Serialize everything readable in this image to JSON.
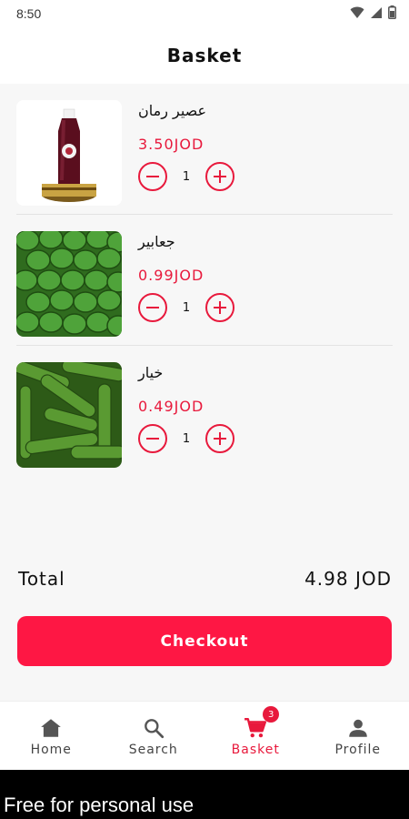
{
  "status_bar": {
    "time": "8:50"
  },
  "header": {
    "title": "Basket"
  },
  "items": [
    {
      "name": "عصير رمان",
      "price": "3.50JOD",
      "quantity": "1",
      "image": "pomegranate-juice-bottle"
    },
    {
      "name": "جعابير",
      "price": "0.99JOD",
      "quantity": "1",
      "image": "green-watermelons"
    },
    {
      "name": "خيار",
      "price": "0.49JOD",
      "quantity": "1",
      "image": "cucumbers"
    }
  ],
  "summary": {
    "total_label": "Total",
    "total_value": "4.98 JOD"
  },
  "checkout": {
    "label": "Checkout"
  },
  "nav": [
    {
      "label": "Home",
      "icon": "home-icon"
    },
    {
      "label": "Search",
      "icon": "search-icon"
    },
    {
      "label": "Basket",
      "icon": "cart-icon",
      "badge": "3",
      "active": true
    },
    {
      "label": "Profile",
      "icon": "person-icon"
    }
  ],
  "footer": {
    "text": "Free for personal use"
  },
  "colors": {
    "accent": "#e8193c",
    "button": "#fe1744",
    "background": "#f7f7f7"
  }
}
